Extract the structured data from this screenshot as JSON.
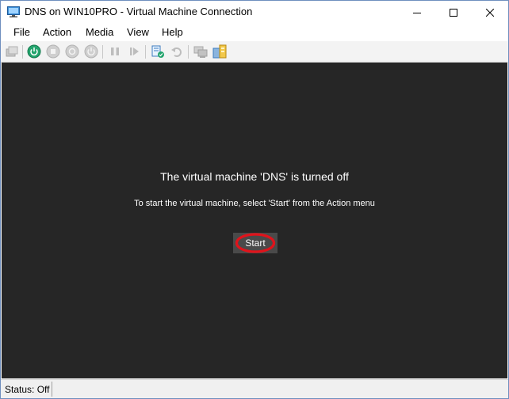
{
  "window": {
    "title": "DNS on WIN10PRO - Virtual Machine Connection",
    "icon": "virtual-machine-icon",
    "controls": [
      "minimize-icon",
      "maximize-icon",
      "close-icon"
    ]
  },
  "menu": [
    {
      "label": "File"
    },
    {
      "label": "Action"
    },
    {
      "label": "Media"
    },
    {
      "label": "View"
    },
    {
      "label": "Help"
    }
  ],
  "toolbar": {
    "items": [
      {
        "icon": "ctrl-alt-del-icon",
        "enabled": false
      },
      {
        "icon": "start-icon",
        "enabled": true
      },
      {
        "icon": "turn-off-icon",
        "enabled": false
      },
      {
        "icon": "shut-down-icon",
        "enabled": false
      },
      {
        "icon": "power-icon",
        "enabled": false
      },
      {
        "icon": "pause-icon",
        "enabled": false
      },
      {
        "icon": "resume-icon",
        "enabled": false
      },
      {
        "icon": "checkpoint-icon",
        "enabled": true
      },
      {
        "icon": "revert-icon",
        "enabled": false
      },
      {
        "icon": "enhanced-session-icon",
        "enabled": false
      },
      {
        "icon": "share-icon",
        "enabled": true
      }
    ]
  },
  "display": {
    "background": "#262626",
    "headline": "The virtual machine 'DNS' is turned off",
    "instruction": "To start the virtual machine, select 'Start' from the Action menu",
    "start_label": "Start",
    "highlight_color": "#e0131b"
  },
  "status": {
    "text": "Status: Off"
  }
}
